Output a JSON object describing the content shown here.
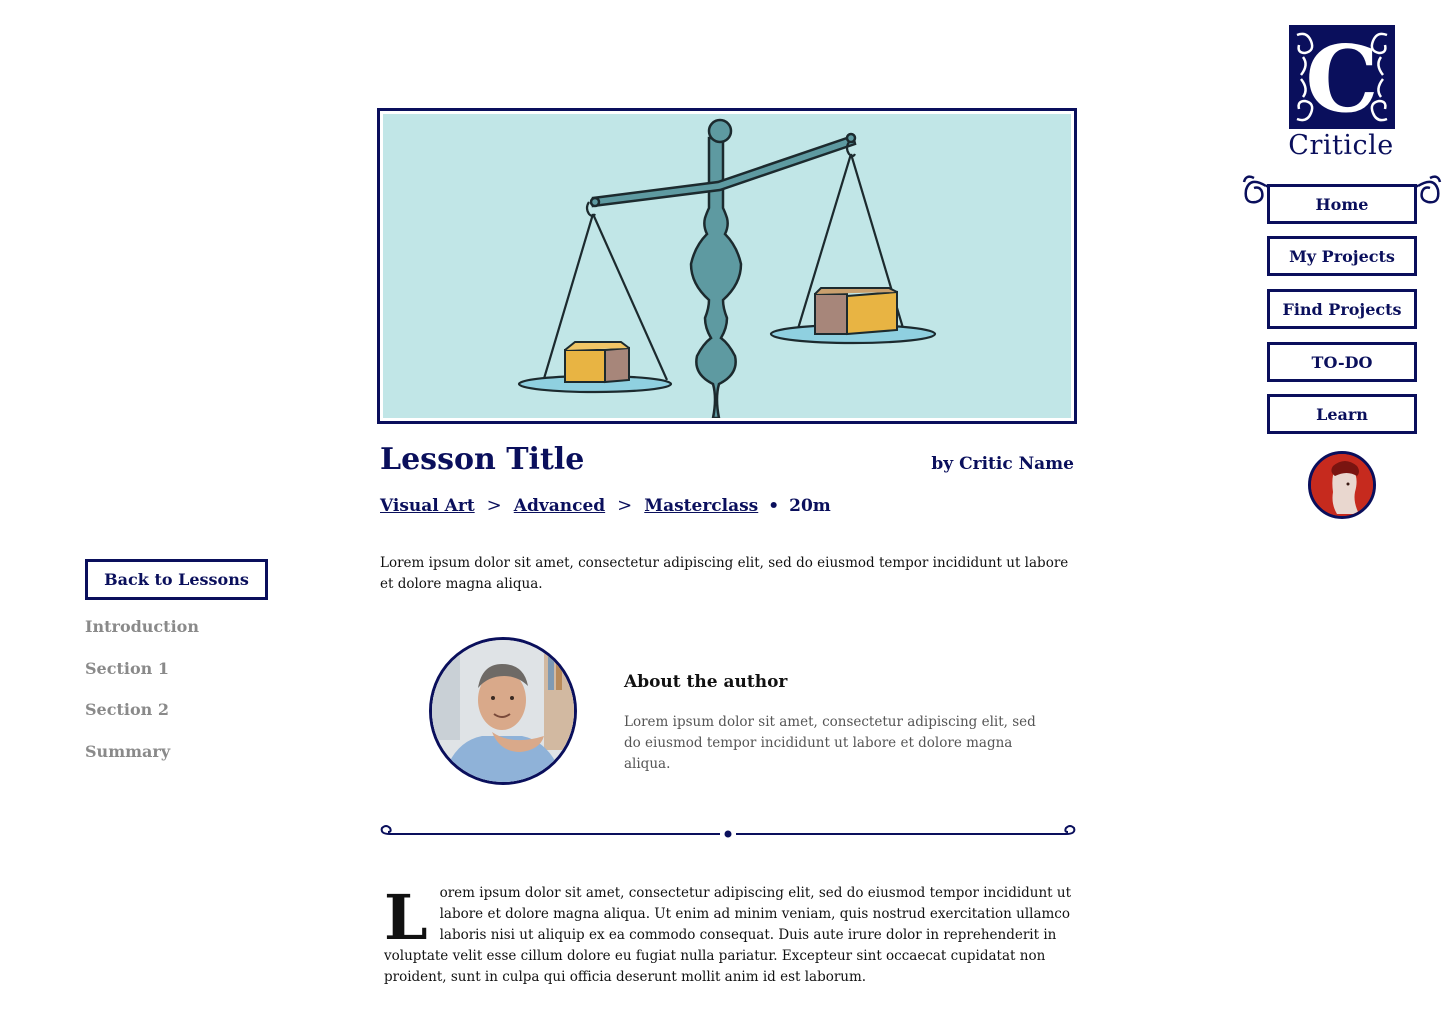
{
  "brand": {
    "name": "Criticle",
    "logo_letter": "C"
  },
  "nav": {
    "items": [
      {
        "label": "Home"
      },
      {
        "label": "My Projects"
      },
      {
        "label": "Find Projects"
      },
      {
        "label": "TO-DO"
      },
      {
        "label": "Learn"
      }
    ]
  },
  "lesson": {
    "title": "Lesson Title",
    "author_line": "by Critic Name",
    "breadcrumb": [
      "Visual Art",
      "Advanced",
      "Masterclass"
    ],
    "duration": "20m",
    "intro": "Lorem ipsum dolor sit amet, consectetur adipiscing elit, sed do eiusmod tempor incididunt ut labore et dolore magna aliqua."
  },
  "sidebar": {
    "back_label": "Back to Lessons",
    "sections": [
      "Introduction",
      "Section 1",
      "Section 2",
      "Summary"
    ]
  },
  "author": {
    "heading": "About the author",
    "bio": "Lorem ipsum dolor sit amet, consectetur adipiscing elit, sed do eiusmod tempor incididunt ut labore et dolore magna aliqua."
  },
  "body": {
    "drop_cap": "L",
    "text": "orem ipsum dolor sit amet, consectetur adipiscing elit, sed do eiusmod tempor incididunt ut labore et dolore magna aliqua. Ut enim ad minim veniam, quis nostrud exercitation ullamco laboris nisi ut aliquip ex ea commodo consequat. Duis aute irure dolor in reprehenderit in voluptate velit esse cillum dolore eu fugiat nulla pariatur. Excepteur sint occaecat cupidatat non proident, sunt in culpa qui officia deserunt mollit anim id est laborum."
  },
  "colors": {
    "primary": "#0a0f5c",
    "hero_bg": "#c1e6e7",
    "muted": "#8a8a8a"
  }
}
